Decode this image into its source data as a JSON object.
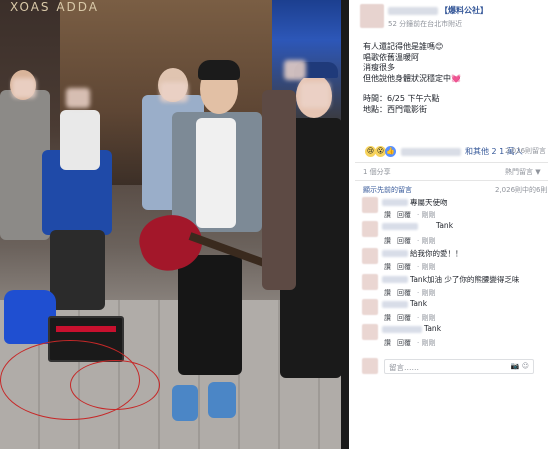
{
  "photo": {
    "sign_text": "XOAS ADDA",
    "alt": ""
  },
  "post": {
    "page_name": "【爆料公社】",
    "meta": "52 分鐘前在台北市附近",
    "lines": [
      "有人還記得他是誰嗎😊",
      "唱歌依舊溫暖阿",
      "消瘦很多",
      "但他說他身體狀況穩定中💓",
      "",
      "時間：6/25 下午六點",
      "地點：西門電影街"
    ]
  },
  "reactions": {
    "icons": [
      "😢",
      "😮",
      "👍"
    ],
    "summary": "和其他 2 1 萬人",
    "comment_count": "2,026則留言"
  },
  "share": {
    "label": "1 個分享",
    "rank_label": "熱門留言 ▼"
  },
  "comments_header": {
    "show_previous": "顯示先前的留言",
    "count": "2,026則中的6則"
  },
  "comments": [
    {
      "text": "專屬天使吻",
      "like": "讚",
      "reply": "回覆",
      "time": "· 剛剛"
    },
    {
      "text": "",
      "name_suffix": "Tank",
      "like": "讚",
      "reply": "回覆",
      "time": "· 剛剛"
    },
    {
      "text": "給我你的愛！！",
      "like": "讚",
      "reply": "回覆",
      "time": "· 剛剛"
    },
    {
      "text": "Tank加油 少了你的熊腰變得乏味",
      "like": "讚",
      "reply": "回覆",
      "time": "· 剛剛"
    },
    {
      "text": "Tank",
      "like": "讚",
      "reply": "回覆",
      "time": "· 剛剛"
    },
    {
      "text": "Tank",
      "like": "讚",
      "reply": "回覆",
      "time": "· 剛剛"
    }
  ],
  "input": {
    "placeholder": "留言……",
    "icons": "📷 ☺"
  },
  "colors": {
    "link": "#365899",
    "muted": "#90949c",
    "divider": "#e5e5e5"
  }
}
